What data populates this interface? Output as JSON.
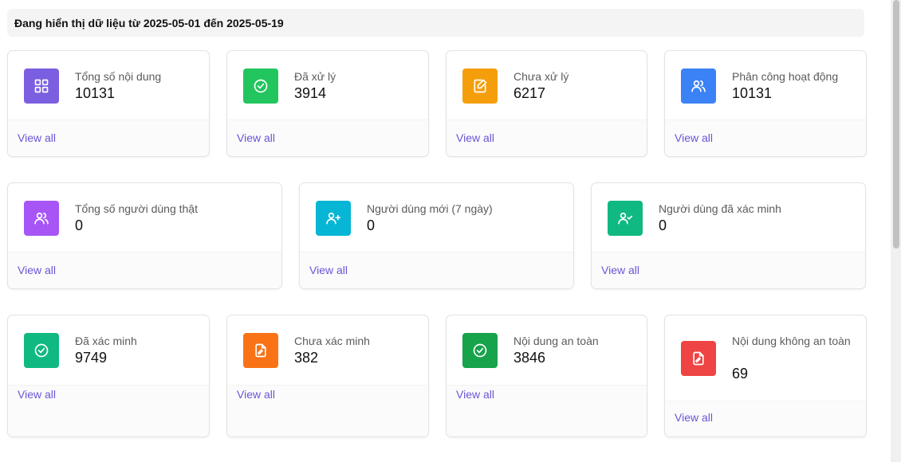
{
  "banner": {
    "text": "Đang hiển thị dữ liệu từ 2025-05-01 đến 2025-05-19"
  },
  "row1": [
    {
      "label": "Tổng số nội dung",
      "value": "10131",
      "link": "View all",
      "icon": "grid-icon",
      "color": "#7b5fe0"
    },
    {
      "label": "Đã xử lý",
      "value": "3914",
      "link": "View all",
      "icon": "check-circle-icon",
      "color": "#22c55e"
    },
    {
      "label": "Chưa xử lý",
      "value": "6217",
      "link": "View all",
      "icon": "edit-icon",
      "color": "#f59e0b"
    },
    {
      "label": "Phân công hoạt động",
      "value": "10131",
      "link": "View all",
      "icon": "users-icon",
      "color": "#3b82f6"
    }
  ],
  "row2": [
    {
      "label": "Tổng số người dùng thật",
      "value": "0",
      "link": "View all",
      "icon": "users-icon",
      "color": "#a855f7"
    },
    {
      "label": "Người dùng mới (7 ngày)",
      "value": "0",
      "link": "View all",
      "icon": "user-plus-icon",
      "color": "#06b6d4"
    },
    {
      "label": "Người dùng đã xác minh",
      "value": "0",
      "link": "View all",
      "icon": "user-check-icon",
      "color": "#10b981"
    }
  ],
  "row3": [
    {
      "label": "Đã xác minh",
      "value": "9749",
      "link": "View all",
      "icon": "check-circle-icon",
      "color": "#10b981"
    },
    {
      "label": "Chưa xác minh",
      "value": "382",
      "link": "View all",
      "icon": "file-edit-icon",
      "color": "#f97316"
    },
    {
      "label": "Nội dung an toàn",
      "value": "3846",
      "link": "View all",
      "icon": "check-circle-icon",
      "color": "#16a34a"
    },
    {
      "label": "Nội dung không an toàn",
      "value": "69",
      "link": "View all",
      "icon": "file-edit-icon",
      "color": "#ef4444"
    }
  ]
}
